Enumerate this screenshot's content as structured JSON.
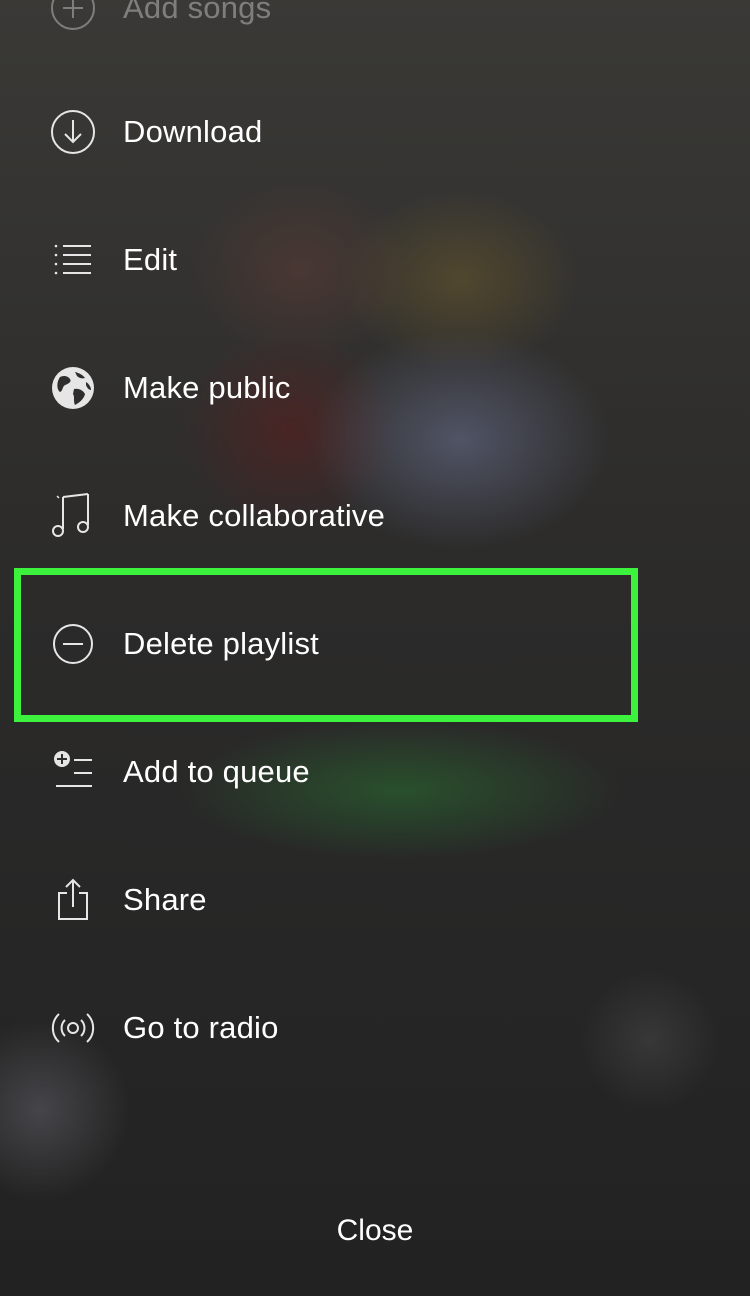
{
  "menu": {
    "items": [
      {
        "label": "Add songs",
        "icon": "add-circle-icon"
      },
      {
        "label": "Download",
        "icon": "download-icon"
      },
      {
        "label": "Edit",
        "icon": "edit-list-icon"
      },
      {
        "label": "Make public",
        "icon": "globe-icon"
      },
      {
        "label": "Make collaborative",
        "icon": "music-note-icon"
      },
      {
        "label": "Delete playlist",
        "icon": "remove-circle-icon"
      },
      {
        "label": "Add to queue",
        "icon": "add-to-queue-icon"
      },
      {
        "label": "Share",
        "icon": "share-icon"
      },
      {
        "label": "Go to radio",
        "icon": "radio-icon"
      }
    ],
    "highlighted_item": "Delete playlist",
    "highlight_color": "#3df23d"
  },
  "footer": {
    "close_label": "Close"
  }
}
